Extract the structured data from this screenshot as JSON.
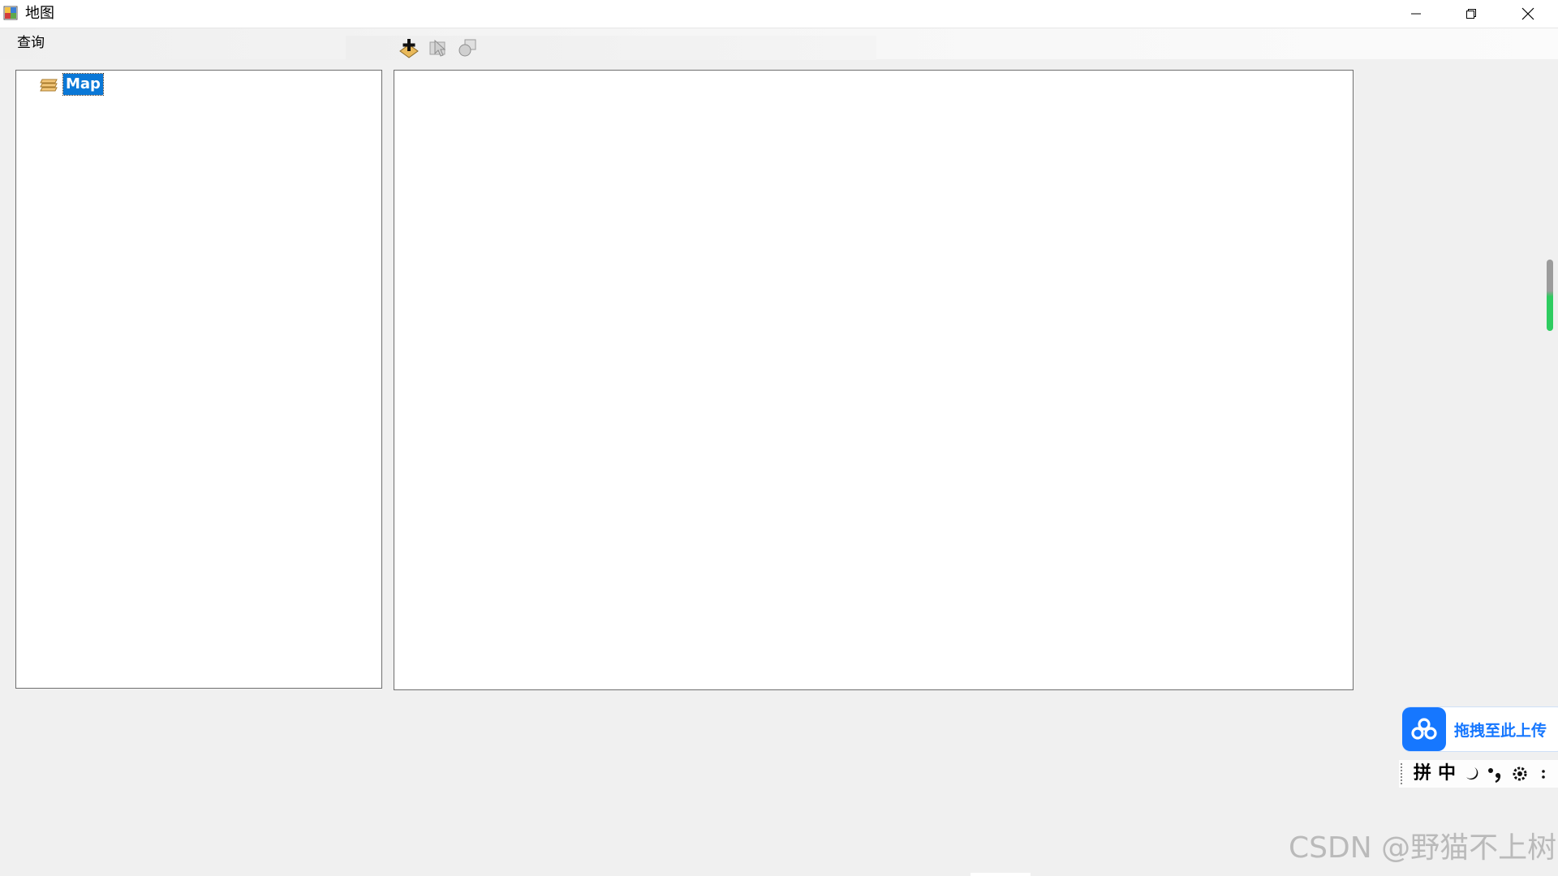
{
  "window": {
    "title": "地图",
    "icon": "app-map-icon"
  },
  "menubar": {
    "items": [
      {
        "label": "查询"
      }
    ]
  },
  "toolbar": {
    "buttons": [
      {
        "name": "add-data-icon",
        "enabled": true
      },
      {
        "name": "select-features-icon",
        "enabled": false
      },
      {
        "name": "clear-selection-icon",
        "enabled": false
      }
    ]
  },
  "toc": {
    "nodes": [
      {
        "label": "Map",
        "icon": "layers-icon",
        "selected": true
      }
    ]
  },
  "upload_widget": {
    "label": "拖拽至此上传",
    "icon": "cloud-icon",
    "color": "#1677ff"
  },
  "ime": {
    "items": [
      "拼",
      "中"
    ]
  },
  "watermark": {
    "text": "CSDN @野猫不上树"
  },
  "colors": {
    "selection": "#0a78d7",
    "indicator_green": "#2ecc60"
  }
}
